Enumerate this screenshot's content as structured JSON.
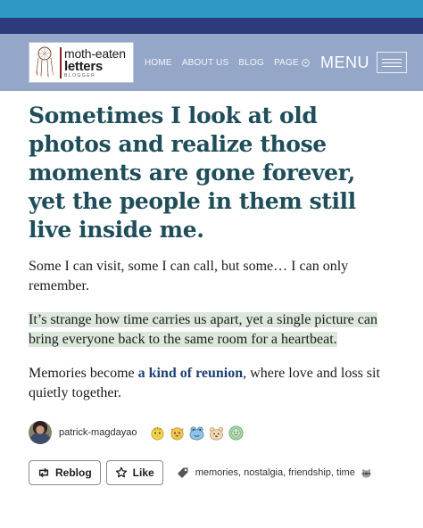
{
  "colors": {
    "band_top": "#2e97c3",
    "band_mid": "#2d3b7c",
    "header_bg": "#95a7c8",
    "title": "#1f4e5a",
    "highlight": "#dde8dd",
    "link": "#1e3f73"
  },
  "logo": {
    "line1": "moth-eaten",
    "line2": "letters",
    "line3": "BLOGGER",
    "art_icon": "dreamcatcher-illustration-icon"
  },
  "nav": {
    "items": [
      "HOME",
      "ABOUT US",
      "BLOG"
    ],
    "page_label": "PAGE",
    "page_icon": "chevron-down-circle-icon",
    "menu_label": "MENU",
    "menu_icon": "hamburger-icon"
  },
  "post": {
    "title": "Sometimes I look at old photos and realize those moments are gone forever, yet the people in them still live inside me.",
    "para1": "Some I can visit, some I can call, but some… I can only remember.",
    "para2": "It’s strange how time carries us apart, yet a single picture can bring everyone back to the same room for a heartbeat.",
    "para3_before": "Memories become ",
    "para3_link": "a kind of reunion",
    "para3_after": ", where love and loss sit quietly together."
  },
  "author": {
    "name": "patrick-magdayao",
    "badges": [
      "chick-badge-icon",
      "cat-badge-icon",
      "frog-badge-icon",
      "bear-badge-icon",
      "smile-badge-icon"
    ]
  },
  "actions": {
    "reblog_label": "Reblog",
    "reblog_icon": "reblog-icon",
    "like_label": "Like",
    "like_icon": "star-icon",
    "tag_icon": "tag-icon",
    "tags_text": "memories, nostalgia, friendship, time",
    "tags_emoji_icon": "raccoon-icon"
  }
}
